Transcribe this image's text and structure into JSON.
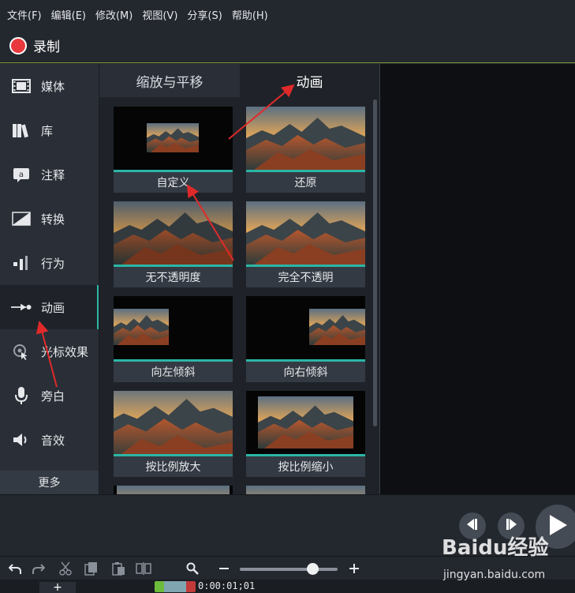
{
  "menubar": {
    "items": [
      {
        "label": "文件(F)"
      },
      {
        "label": "编辑(E)"
      },
      {
        "label": "修改(M)"
      },
      {
        "label": "视图(V)"
      },
      {
        "label": "分享(S)"
      },
      {
        "label": "帮助(H)"
      }
    ]
  },
  "record": {
    "label": "录制",
    "color": "#e8383d"
  },
  "sidebar": {
    "items": [
      {
        "label": "媒体",
        "icon": "film-icon"
      },
      {
        "label": "库",
        "icon": "library-icon"
      },
      {
        "label": "注释",
        "icon": "annotation-icon"
      },
      {
        "label": "转换",
        "icon": "transition-icon"
      },
      {
        "label": "行为",
        "icon": "behavior-icon"
      },
      {
        "label": "动画",
        "icon": "animation-icon",
        "active": true
      },
      {
        "label": "光标效果",
        "icon": "cursor-effect-icon"
      },
      {
        "label": "旁白",
        "icon": "microphone-icon"
      },
      {
        "label": "音效",
        "icon": "audio-icon"
      }
    ],
    "more_label": "更多"
  },
  "tabs": {
    "zoom_pan": "缩放与平移",
    "animation": "动画",
    "active": "animation"
  },
  "presets": [
    {
      "label": "自定义"
    },
    {
      "label": "还原"
    },
    {
      "label": "无不透明度"
    },
    {
      "label": "完全不透明"
    },
    {
      "label": "向左倾斜"
    },
    {
      "label": "向右倾斜"
    },
    {
      "label": "按比例放大"
    },
    {
      "label": "按比例缩小"
    }
  ],
  "timeline": {
    "time": "0:00:01;01",
    "add_label": "+"
  },
  "toolbar": {
    "zoom_level": 0.7
  },
  "watermark": {
    "brand": "Baidu经验",
    "url": "jingyan.baidu.com"
  },
  "colors": {
    "accent": "#2bb5a6",
    "annotation_arrow": "#e02a2a",
    "record": "#e8383d"
  }
}
